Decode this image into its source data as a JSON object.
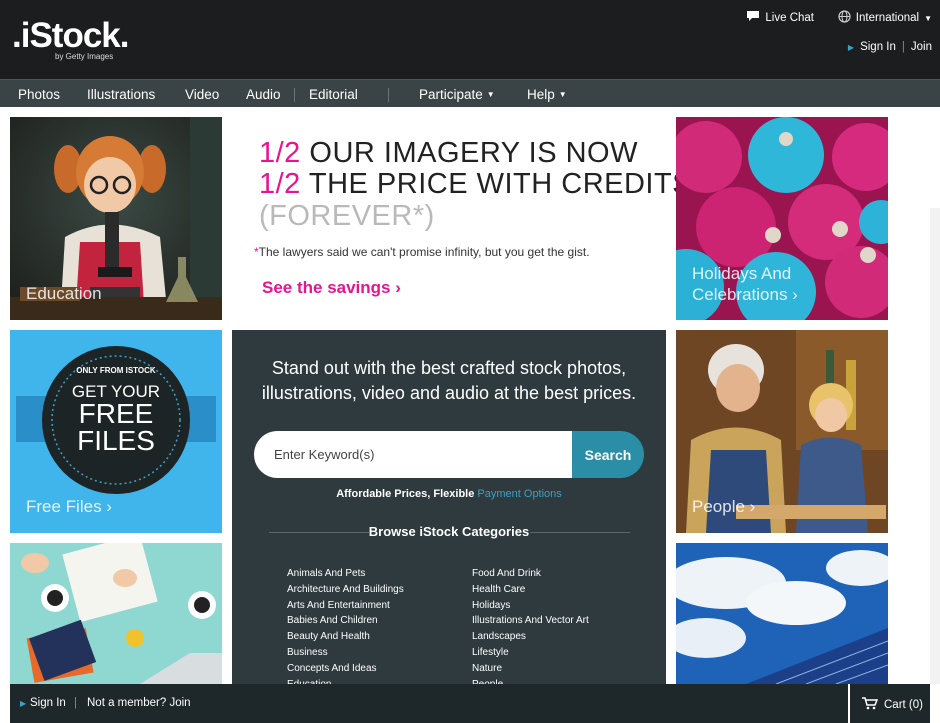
{
  "header": {
    "logo_main": ".iStock.",
    "logo_sub": "by Getty Images",
    "live_chat": "Live Chat",
    "international": "International",
    "sign_in": "Sign In",
    "join": "Join"
  },
  "nav": {
    "items": [
      "Photos",
      "Illustrations",
      "Video",
      "Audio",
      "Editorial"
    ],
    "participate": "Participate",
    "help": "Help"
  },
  "tiles": {
    "education": "Education",
    "holidays": "Holidays And\nCelebrations ›",
    "free_files_badge_top": "ONLY FROM ISTOCK",
    "free_files_badge_get": "GET YOUR",
    "free_files_badge_free": "FREE",
    "free_files_badge_files": "FILES",
    "free_files": "Free Files ›",
    "people": "People ›"
  },
  "promo": {
    "half": "1/2",
    "line1": "OUR IMAGERY IS NOW",
    "line2": "THE PRICE WITH CREDITS",
    "line3": "(FOREVER*)",
    "note_ast": "*",
    "note": "The lawyers said we can't promise infinity, but you get the gist.",
    "link": "See the savings ›"
  },
  "panel": {
    "headline_1": "Stand out with the best crafted stock photos,",
    "headline_2": "illustrations, video and audio at the best prices.",
    "search_placeholder": "Enter Keyword(s)",
    "search_button": "Search",
    "afford_text": "Affordable Prices, Flexible",
    "afford_link": "Payment Options",
    "browse_title": "Browse iStock Categories",
    "categories_left": [
      "Animals And Pets",
      "Architecture And Buildings",
      "Arts And Entertainment",
      "Babies And Children",
      "Beauty And Health",
      "Business",
      "Concepts And Ideas",
      "Education"
    ],
    "categories_right": [
      "Food And Drink",
      "Health Care",
      "Holidays",
      "Illustrations And Vector Art",
      "Landscapes",
      "Lifestyle",
      "Nature",
      "People"
    ]
  },
  "bottom": {
    "sign_in": "Sign In",
    "not_member": "Not a member? Join",
    "cart": "Cart (0)"
  },
  "colors": {
    "accent_pink": "#e5158d",
    "accent_teal": "#2a8fa6",
    "panel_bg": "#2e3a3d",
    "header_bg": "#1b1d1e"
  }
}
